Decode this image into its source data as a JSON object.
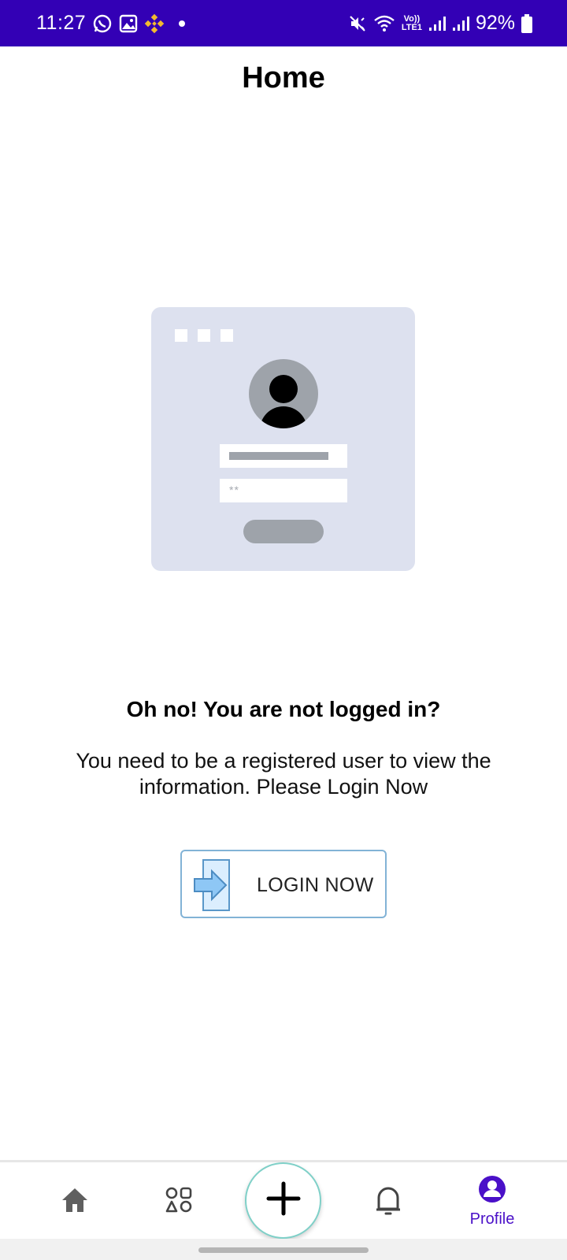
{
  "status_bar": {
    "time": "11:27",
    "lte_label_top": "Vo))",
    "lte_label_bottom": "LTE1",
    "battery": "92%",
    "left_icons": [
      "whatsapp-icon",
      "gallery-icon",
      "binance-icon",
      "dot-icon"
    ],
    "right_icons": [
      "mute-icon",
      "wifi-icon",
      "signal-icon",
      "signal-icon",
      "battery-icon"
    ]
  },
  "header": {
    "title": "Home"
  },
  "illustration": {
    "password_mask": "**"
  },
  "message": {
    "heading": "Oh no! You are not logged in?",
    "body": "You need to be a registered user to view the information. Please Login Now"
  },
  "login_button": {
    "label": "LOGIN NOW",
    "icon": "login-arrow-icon"
  },
  "bottom_nav": {
    "items": [
      {
        "id": "home",
        "icon": "home-icon",
        "label": ""
      },
      {
        "id": "categories",
        "icon": "categories-icon",
        "label": ""
      },
      {
        "id": "add",
        "icon": "plus-icon",
        "label": ""
      },
      {
        "id": "notifications",
        "icon": "bell-icon",
        "label": ""
      },
      {
        "id": "profile",
        "icon": "profile-icon",
        "label": "Profile"
      }
    ],
    "active": "profile"
  },
  "colors": {
    "status_bar": "#3300b5",
    "accent": "#4a10c8",
    "illustration_bg": "#dde1ef",
    "login_border": "#82b3d6",
    "fab_border": "#7fd0c8"
  }
}
